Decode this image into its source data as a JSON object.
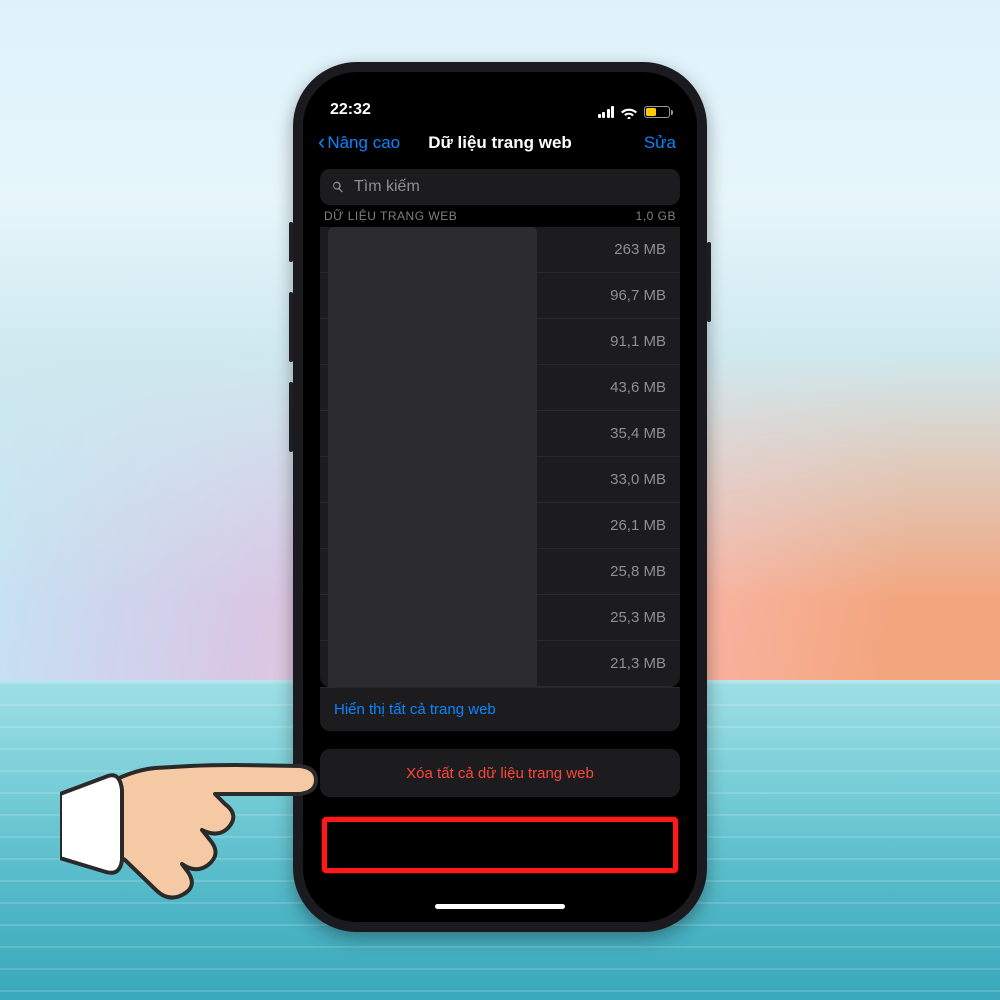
{
  "status": {
    "time": "22:32"
  },
  "nav": {
    "back_label": "Nâng cao",
    "title": "Dữ liệu trang web",
    "edit_label": "Sửa"
  },
  "search": {
    "placeholder": "Tìm kiếm"
  },
  "section": {
    "header": "DỮ LIỆU TRANG WEB",
    "total": "1,0 GB"
  },
  "rows": [
    {
      "value": "263 MB"
    },
    {
      "value": "96,7 MB"
    },
    {
      "value": "91,1 MB"
    },
    {
      "value": "43,6 MB"
    },
    {
      "value": "35,4 MB"
    },
    {
      "value": "33,0 MB"
    },
    {
      "value": "26,1 MB"
    },
    {
      "value": "25,8 MB"
    },
    {
      "value": "25,3 MB"
    },
    {
      "value": "21,3 MB"
    }
  ],
  "show_all_label": "Hiển thị tất cả trang web",
  "delete_label": "Xóa tất cả dữ liệu trang web"
}
